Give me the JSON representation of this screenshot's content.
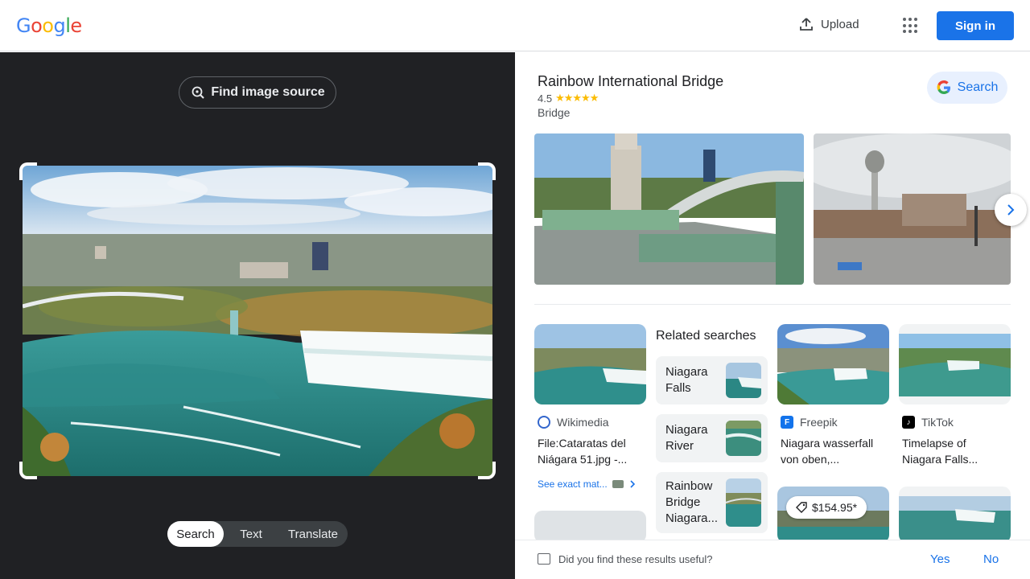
{
  "header": {
    "logo": [
      "G",
      "o",
      "o",
      "g",
      "l",
      "e"
    ],
    "logo_colors": [
      "#4285f4",
      "#ea4335",
      "#fbbc05",
      "#4285f4",
      "#34a853",
      "#ea4335"
    ],
    "upload_label": "Upload",
    "signin_label": "Sign in"
  },
  "left_panel": {
    "find_source_label": "Find image source",
    "modes": [
      "Search",
      "Text",
      "Translate"
    ],
    "active_mode": "Search"
  },
  "knowledge_panel": {
    "title": "Rainbow International Bridge",
    "rating": "4.5",
    "stars": "★★★★★",
    "type": "Bridge",
    "search_label": "Search"
  },
  "results": [
    {
      "source": "Wikimedia",
      "title_line1": "File:Cataratas del",
      "title_line2": "Niágara 51.jpg -..."
    },
    {
      "source": "Freepik",
      "title_line1": "Niagara wasserfall",
      "title_line2": "von oben,..."
    },
    {
      "source": "TikTok",
      "title_line1": "Timelapse of",
      "title_line2": "Niagara Falls..."
    }
  ],
  "see_exact_matches": "See exact mat...",
  "related": {
    "heading": "Related searches",
    "items": [
      {
        "line1": "Niagara",
        "line2": "Falls",
        "line3": ""
      },
      {
        "line1": "Niagara",
        "line2": "River",
        "line3": ""
      },
      {
        "line1": "Rainbow",
        "line2": "Bridge",
        "line3": "Niagara..."
      }
    ]
  },
  "price_tag": "$154.95*",
  "feedback": {
    "question": "Did you find these results useful?",
    "yes": "Yes",
    "no": "No"
  },
  "colors": {
    "accent": "#1a73e8",
    "dark_panel": "#202124",
    "star": "#fbbc04"
  }
}
